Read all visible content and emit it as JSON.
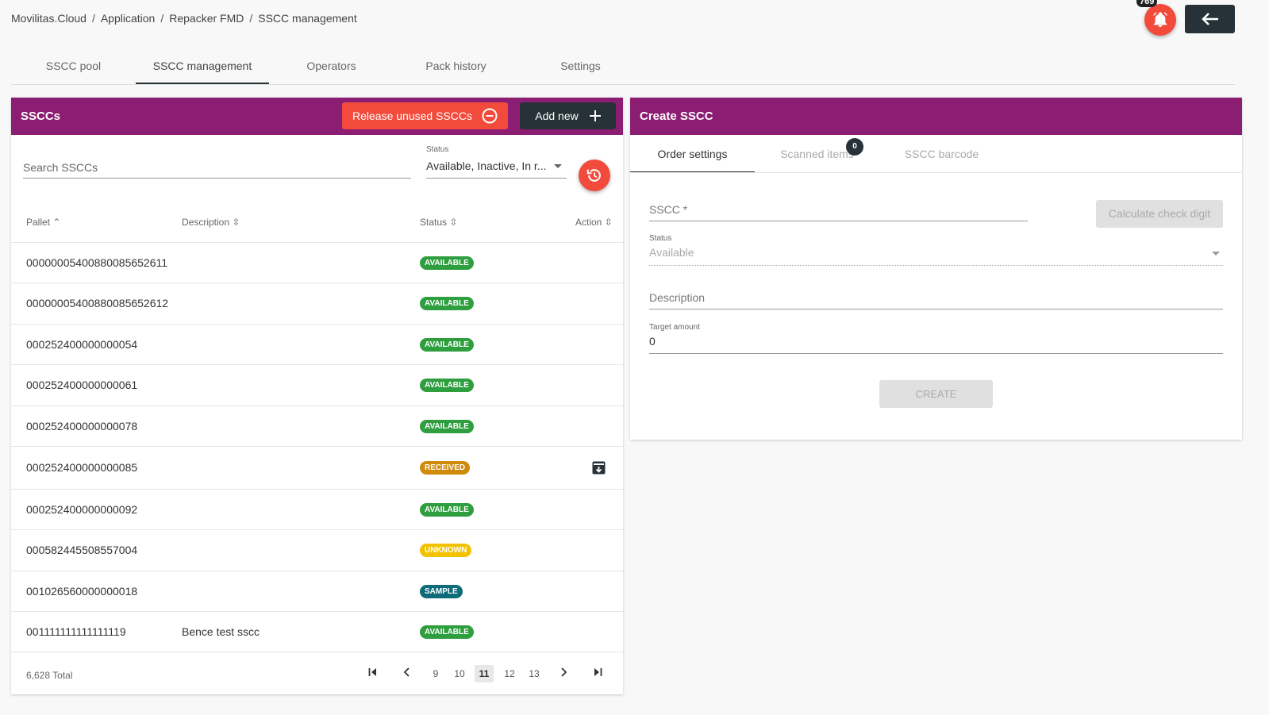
{
  "breadcrumb": [
    "Movilitas.Cloud",
    "Application",
    "Repacker FMD",
    "SSCC management"
  ],
  "notifications": {
    "count": "769",
    "icon": "bell-icon"
  },
  "back_icon": "arrow-left-icon",
  "tabs": [
    "SSCC pool",
    "SSCC management",
    "Operators",
    "Pack history",
    "Settings"
  ],
  "active_tab": "SSCC management",
  "left": {
    "title": "SSCCs",
    "release_label": "Release unused SSCCs",
    "add_label": "Add new",
    "search_placeholder": "Search SSCCs",
    "status_label": "Status",
    "status_value": "Available, Inactive, In r...",
    "columns": {
      "pallet": "Pallet",
      "description": "Description",
      "status": "Status",
      "action": "Action"
    },
    "rows": [
      {
        "pallet": "00000005400880085652611",
        "description": "",
        "status": "AVAILABLE",
        "color": "#2e9e3f"
      },
      {
        "pallet": "00000005400880085652612",
        "description": "",
        "status": "AVAILABLE",
        "color": "#2e9e3f"
      },
      {
        "pallet": "000252400000000054",
        "description": "",
        "status": "AVAILABLE",
        "color": "#2e9e3f"
      },
      {
        "pallet": "000252400000000061",
        "description": "",
        "status": "AVAILABLE",
        "color": "#2e9e3f"
      },
      {
        "pallet": "000252400000000078",
        "description": "",
        "status": "AVAILABLE",
        "color": "#2e9e3f"
      },
      {
        "pallet": "000252400000000085",
        "description": "",
        "status": "RECEIVED",
        "color": "#d08a0a"
      },
      {
        "pallet": "000252400000000092",
        "description": "",
        "status": "AVAILABLE",
        "color": "#2e9e3f"
      },
      {
        "pallet": "000582445508557004",
        "description": "",
        "status": "UNKNOWN",
        "color": "#f2c200"
      },
      {
        "pallet": "001026560000000018",
        "description": "",
        "status": "SAMPLE",
        "color": "#0e6c7a"
      },
      {
        "pallet": "001111111111111119",
        "description": "Bence test sscc",
        "status": "AVAILABLE",
        "color": "#2e9e3f"
      }
    ],
    "total": "6,628 Total",
    "pages": [
      "9",
      "10",
      "11",
      "12",
      "13"
    ],
    "current_page": "11"
  },
  "right": {
    "title": "Create SSCC",
    "tabs": [
      "Order settings",
      "Scanned items",
      "SSCC barcode"
    ],
    "scanned_count": "0",
    "sscc_placeholder": "SSCC *",
    "calc_label": "Calculate check digit",
    "status_label": "Status",
    "status_value": "Available",
    "description_placeholder": "Description",
    "target_label": "Target amount",
    "target_value": "0",
    "create_label": "CREATE"
  }
}
